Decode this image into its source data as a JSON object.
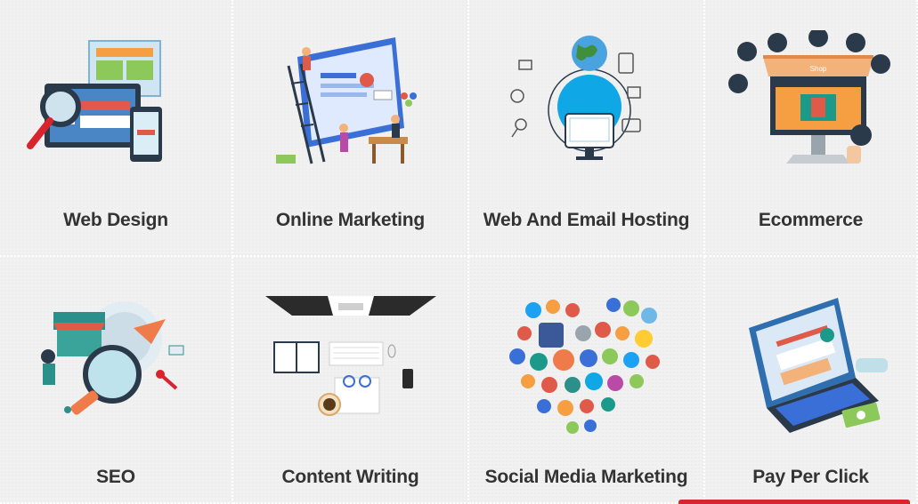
{
  "services": [
    {
      "title": "Web Design",
      "icon": "web-design-icon"
    },
    {
      "title": "Online Marketing",
      "icon": "online-marketing-icon"
    },
    {
      "title": "Web And Email Hosting",
      "icon": "hosting-icon"
    },
    {
      "title": "Ecommerce",
      "icon": "ecommerce-icon"
    },
    {
      "title": "SEO",
      "icon": "seo-icon"
    },
    {
      "title": "Content Writing",
      "icon": "content-writing-icon"
    },
    {
      "title": "Social Media Marketing",
      "icon": "social-media-icon"
    },
    {
      "title": "Pay Per Click",
      "icon": "pay-per-click-icon"
    }
  ],
  "ecommerce_awning_text": "Shop",
  "colors": {
    "accent": "#d9232d",
    "title": "#333333",
    "card_bg": "#f1f1f1"
  }
}
